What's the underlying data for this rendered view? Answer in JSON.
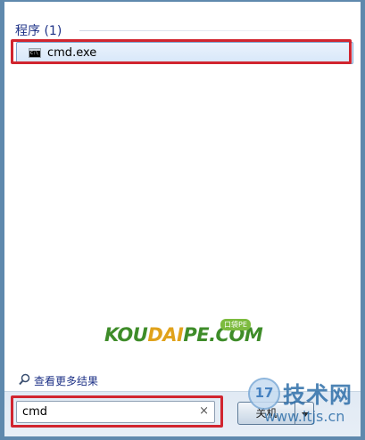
{
  "results": {
    "group_header": "程序 (1)",
    "items": [
      {
        "label": "cmd.exe",
        "icon": "cmd-console-icon"
      }
    ]
  },
  "see_more": {
    "label": "查看更多结果",
    "icon": "magnifier-icon"
  },
  "search": {
    "value": "cmd",
    "clear_symbol": "×"
  },
  "shutdown": {
    "label": "关机"
  },
  "watermarks": {
    "koudaipe": {
      "k": "KOU",
      "d": "DAI",
      "rest": "PE.COM",
      "tag": "口袋PE"
    },
    "site": {
      "badge": "17",
      "name": "技术网",
      "url": "www.itjs.cn"
    }
  },
  "colors": {
    "highlight_border": "#d1252f",
    "header_text": "#1e3287",
    "frame": "#5f89ad"
  }
}
